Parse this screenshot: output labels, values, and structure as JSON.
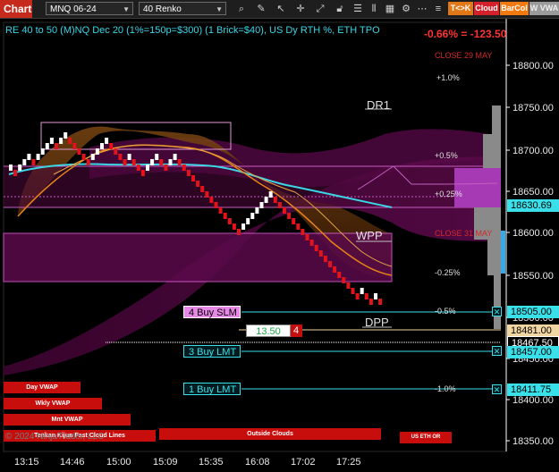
{
  "toolbar": {
    "chart_tab": "Chart",
    "instrument": "MNQ 06-24",
    "bar_type": "40 Renko",
    "buttons": [
      {
        "label": "T<>K",
        "color": "#e07818"
      },
      {
        "label": "Cloud",
        "color": "#d4202a"
      },
      {
        "label": "BarCol",
        "color": "#f07a10"
      },
      {
        "label": "W VWA",
        "color": "#9a9a9a"
      }
    ],
    "icons": [
      "magnifier-icon",
      "pencil-icon",
      "cursor-icon",
      "crosshair-icon",
      "expand-icon",
      "unlock-icon",
      "list-icon",
      "bars-icon",
      "data-box-icon",
      "properties-icon",
      "more-icon",
      "menu-icon"
    ]
  },
  "overlay": {
    "subtitle": "RE 40 to 50 (M)NQ Dec 20 (1%=150p=$300) (1 Brick=$40), US Dy RTH %, ETH TPO",
    "daily_change": "-0.66% = -123.50",
    "close_29": "CLOSE 29 MAY",
    "close_31": "CLOSE 31 MAY",
    "dr1": "DR1",
    "wpp": "WPP",
    "dpp": "DPP",
    "pct_labels": [
      "+1.0%",
      "+0.5%",
      "+0.25%",
      "-0.25%",
      "-0.5%",
      "-1.0%"
    ],
    "orders": [
      {
        "label": "4 Buy SLM",
        "price": "18505.00"
      },
      {
        "label": "3 Buy LMT",
        "price": "18457.00"
      },
      {
        "label": "1 Buy LMT",
        "price": "18411.75"
      }
    ],
    "position_value": "13.50",
    "position_qty": "4",
    "vwap_bars": [
      "Day VWAP",
      "Wkly VWAP",
      "Mnt VWAP",
      "Tenkan Kijun Fast Cloud Lines",
      "Outside Clouds",
      "US ETH OR"
    ],
    "copyright": "© 2024 NinjaTrader, LLC"
  },
  "price_axis": {
    "ticks": [
      "18800.00",
      "18750.00",
      "18700.00",
      "18650.00",
      "18600.00",
      "18550.00",
      "18500.00",
      "18450.00",
      "18400.00",
      "18350.00"
    ],
    "markers": [
      {
        "label": "18630.69",
        "bg": "#39e0ea",
        "fg": "#000000"
      },
      {
        "label": "18481.00",
        "bg": "#f2d6a2",
        "fg": "#000000"
      },
      {
        "label": "18467.50",
        "bg": "#000000",
        "fg": "#ffffff"
      }
    ]
  },
  "time_axis": {
    "ticks": [
      "13:15",
      "14:46",
      "15:00",
      "15:09",
      "15:35",
      "16:08",
      "17:02",
      "17:25"
    ]
  },
  "colors": {
    "ema_cyan": "#3ad7e6",
    "ema_orange": "#e88418",
    "cloud_purple": "#6a0e58",
    "order_cyan": "#39e0ea",
    "up_brick": "#ffffff",
    "down_brick": "#e4121a"
  }
}
